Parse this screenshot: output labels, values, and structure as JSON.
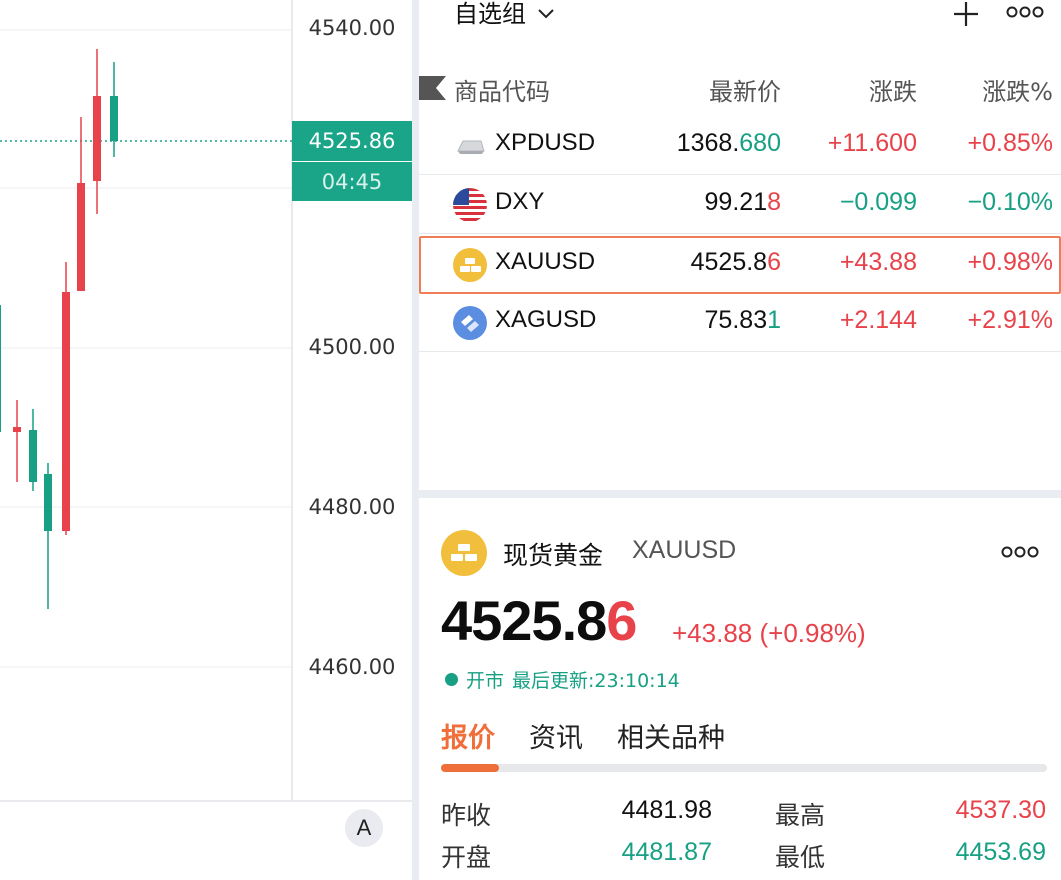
{
  "chart": {
    "price_axis": [
      "4540.00",
      "4500.00",
      "4480.00",
      "4460.00"
    ],
    "current_price": "4525.86",
    "countdown": "04:45",
    "scale_button": "A",
    "colors": {
      "up": "#e8424a",
      "down": "#17a083",
      "tag": "#1aa589"
    }
  },
  "watchlist": {
    "group_name": "自选组",
    "columns": {
      "symbol": "商品代码",
      "last": "最新价",
      "change": "涨跌",
      "percent": "涨跌%"
    },
    "rows": [
      {
        "symbol": "XPDUSD",
        "icon": "palladium-bar-icon",
        "last_main": "1368.",
        "last_tail": "680",
        "last_tail_color": "green",
        "change": "+11.600",
        "percent": "+0.85%",
        "dir": "up"
      },
      {
        "symbol": "DXY",
        "icon": "us-flag-icon",
        "last_main": "99.21",
        "last_tail": "8",
        "last_tail_color": "red",
        "change": "−0.099",
        "percent": "−0.10%",
        "dir": "down"
      },
      {
        "symbol": "XAUUSD",
        "icon": "gold-bars-icon",
        "last_main": "4525.8",
        "last_tail": "6",
        "last_tail_color": "red",
        "change": "+43.88",
        "percent": "+0.98%",
        "dir": "up"
      },
      {
        "symbol": "XAGUSD",
        "icon": "silver-icon",
        "last_main": "75.83",
        "last_tail": "1",
        "last_tail_color": "green",
        "change": "+2.144",
        "percent": "+2.91%",
        "dir": "up"
      }
    ]
  },
  "detail": {
    "name": "现货黄金",
    "symbol": "XAUUSD",
    "price_main": "4525.8",
    "price_tail": "6",
    "change": "+43.88 (+0.98%)",
    "status": "开市",
    "updated": "最后更新:23:10:14",
    "tabs": [
      "报价",
      "资讯",
      "相关品种"
    ],
    "quotes": [
      {
        "label": "昨收",
        "value": "4481.98",
        "label2": "最高",
        "value2": "4537.30"
      },
      {
        "label": "开盘",
        "value": "4481.87",
        "label2": "最低",
        "value2": "4453.69"
      }
    ]
  }
}
